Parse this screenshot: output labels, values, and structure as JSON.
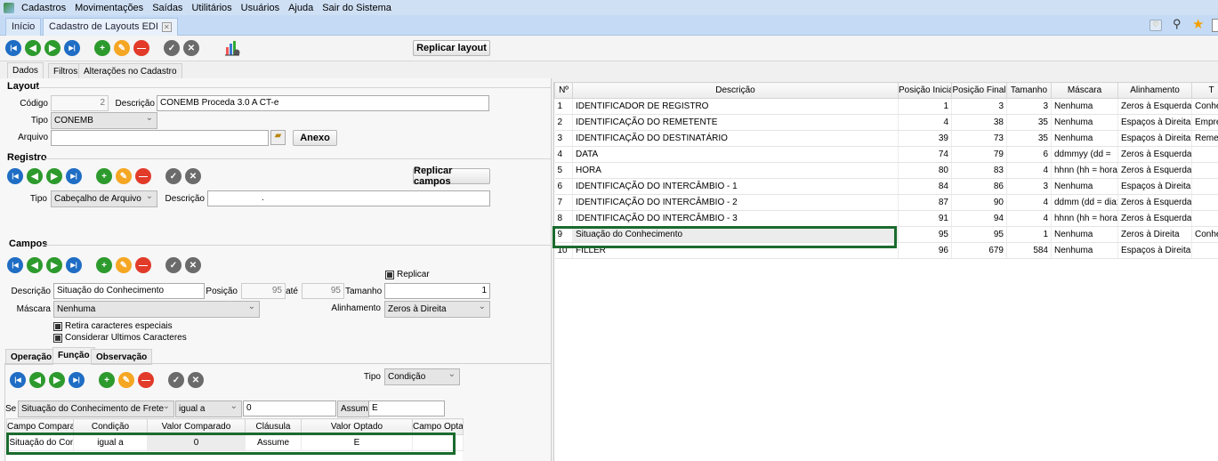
{
  "menu": [
    "Cadastros",
    "Movimentações",
    "Saídas",
    "Utilitários",
    "Usuários",
    "Ajuda",
    "Sair do Sistema"
  ],
  "tabs": {
    "home": "Início",
    "layouts": "Cadastro de Layouts EDI"
  },
  "toolbar": {
    "replicar_layout": "Replicar layout"
  },
  "icons": [
    "first-record-icon",
    "previous-record-icon",
    "next-record-icon",
    "last-record-icon",
    "|",
    "add-icon",
    "edit-icon",
    "delete-icon",
    "|",
    "confirm-icon",
    "cancel-icon"
  ],
  "subtabs": [
    "Dados",
    "Filtros",
    "Alterações no Cadastro"
  ],
  "layout": {
    "title": "Layout",
    "codigo_label": "Código",
    "codigo": "2",
    "descricao_label": "Descrição",
    "descricao": "CONEMB Proceda 3.0 A CT-e",
    "tipo_label": "Tipo",
    "tipo": "CONEMB",
    "arquivo_label": "Arquivo",
    "arquivo": "",
    "anexo": "Anexo"
  },
  "registro": {
    "title": "Registro",
    "replicar": "Replicar campos",
    "tipo_label": "Tipo",
    "tipo": "Cabeçalho de Arquivo",
    "descricao_label": "Descrição",
    "descricao": "."
  },
  "campos": {
    "title": "Campos",
    "replicar": "Replicar",
    "descricao_label": "Descrição",
    "descricao": "Situação do Conhecimento",
    "posicao_label": "Posição",
    "posicao": "95",
    "ate_label": "até",
    "ate": "95",
    "tamanho_label": "Tamanho",
    "tamanho": "1",
    "mascara_label": "Máscara",
    "mascara": "Nenhuma",
    "alinhamento_label": "Alinhamento",
    "alinhamento": "Zeros à Direita",
    "retira": "Retira caracteres especiais",
    "considerar": "Considerar Ultimos Caracteres"
  },
  "func_tabs": [
    "Operação",
    "Função",
    "Observação"
  ],
  "funcao": {
    "tipo_label": "Tipo",
    "tipo": "Condição",
    "se_label": "Se",
    "campo": "Situação do Conhecimento de Frete",
    "condicao": "igual a",
    "valor": "0",
    "clausula": "Assume",
    "optado": "E",
    "columns": [
      "Campo Comparado",
      "Condição",
      "Valor Comparado",
      "Cláusula",
      "Valor Optado",
      "Campo Optado"
    ],
    "rows": [
      [
        "Situação do Conhecimento",
        "igual a",
        "0",
        "Assume",
        "E",
        ""
      ]
    ]
  },
  "grid": {
    "columns": [
      "Nº",
      "Descrição",
      "Posição Inicial",
      "Posição Final",
      "Tamanho",
      "Máscara",
      "Alinhamento",
      "T"
    ],
    "rows": [
      [
        "1",
        "IDENTIFICADOR DE REGISTRO",
        "1",
        "3",
        "3",
        "Nenhuma",
        "Zeros à Esquerda",
        "Conhec"
      ],
      [
        "2",
        "IDENTIFICAÇÃO DO REMETENTE",
        "4",
        "38",
        "35",
        "Nenhuma",
        "Espaços à Direita",
        "Empres"
      ],
      [
        "3",
        "IDENTIFICAÇÃO DO DESTINATÁRIO",
        "39",
        "73",
        "35",
        "Nenhuma",
        "Espaços à Direita",
        "Remete"
      ],
      [
        "4",
        "DATA",
        "74",
        "79",
        "6",
        "ddmmyy (dd =",
        "Zeros à Esquerda",
        ""
      ],
      [
        "5",
        "HORA",
        "80",
        "83",
        "4",
        "hhnn (hh = hora;",
        "Zeros à Esquerda",
        ""
      ],
      [
        "6",
        "IDENTIFICAÇÃO DO INTERCÂMBIO - 1",
        "84",
        "86",
        "3",
        "Nenhuma",
        "Espaços à Direita",
        ""
      ],
      [
        "7",
        "IDENTIFICAÇÃO DO INTERCÂMBIO - 2",
        "87",
        "90",
        "4",
        "ddmm (dd = dia;",
        "Zeros à Esquerda",
        ""
      ],
      [
        "8",
        "IDENTIFICAÇÃO DO INTERCÂMBIO - 3",
        "91",
        "94",
        "4",
        "hhnn (hh = hora;",
        "Zeros à Esquerda",
        ""
      ],
      [
        "9",
        "Situação do Conhecimento",
        "95",
        "95",
        "1",
        "Nenhuma",
        "Zeros à Direita",
        "Conhec"
      ],
      [
        "10",
        "FILLER",
        "96",
        "679",
        "584",
        "Nenhuma",
        "Espaços à Direita",
        ""
      ]
    ]
  }
}
